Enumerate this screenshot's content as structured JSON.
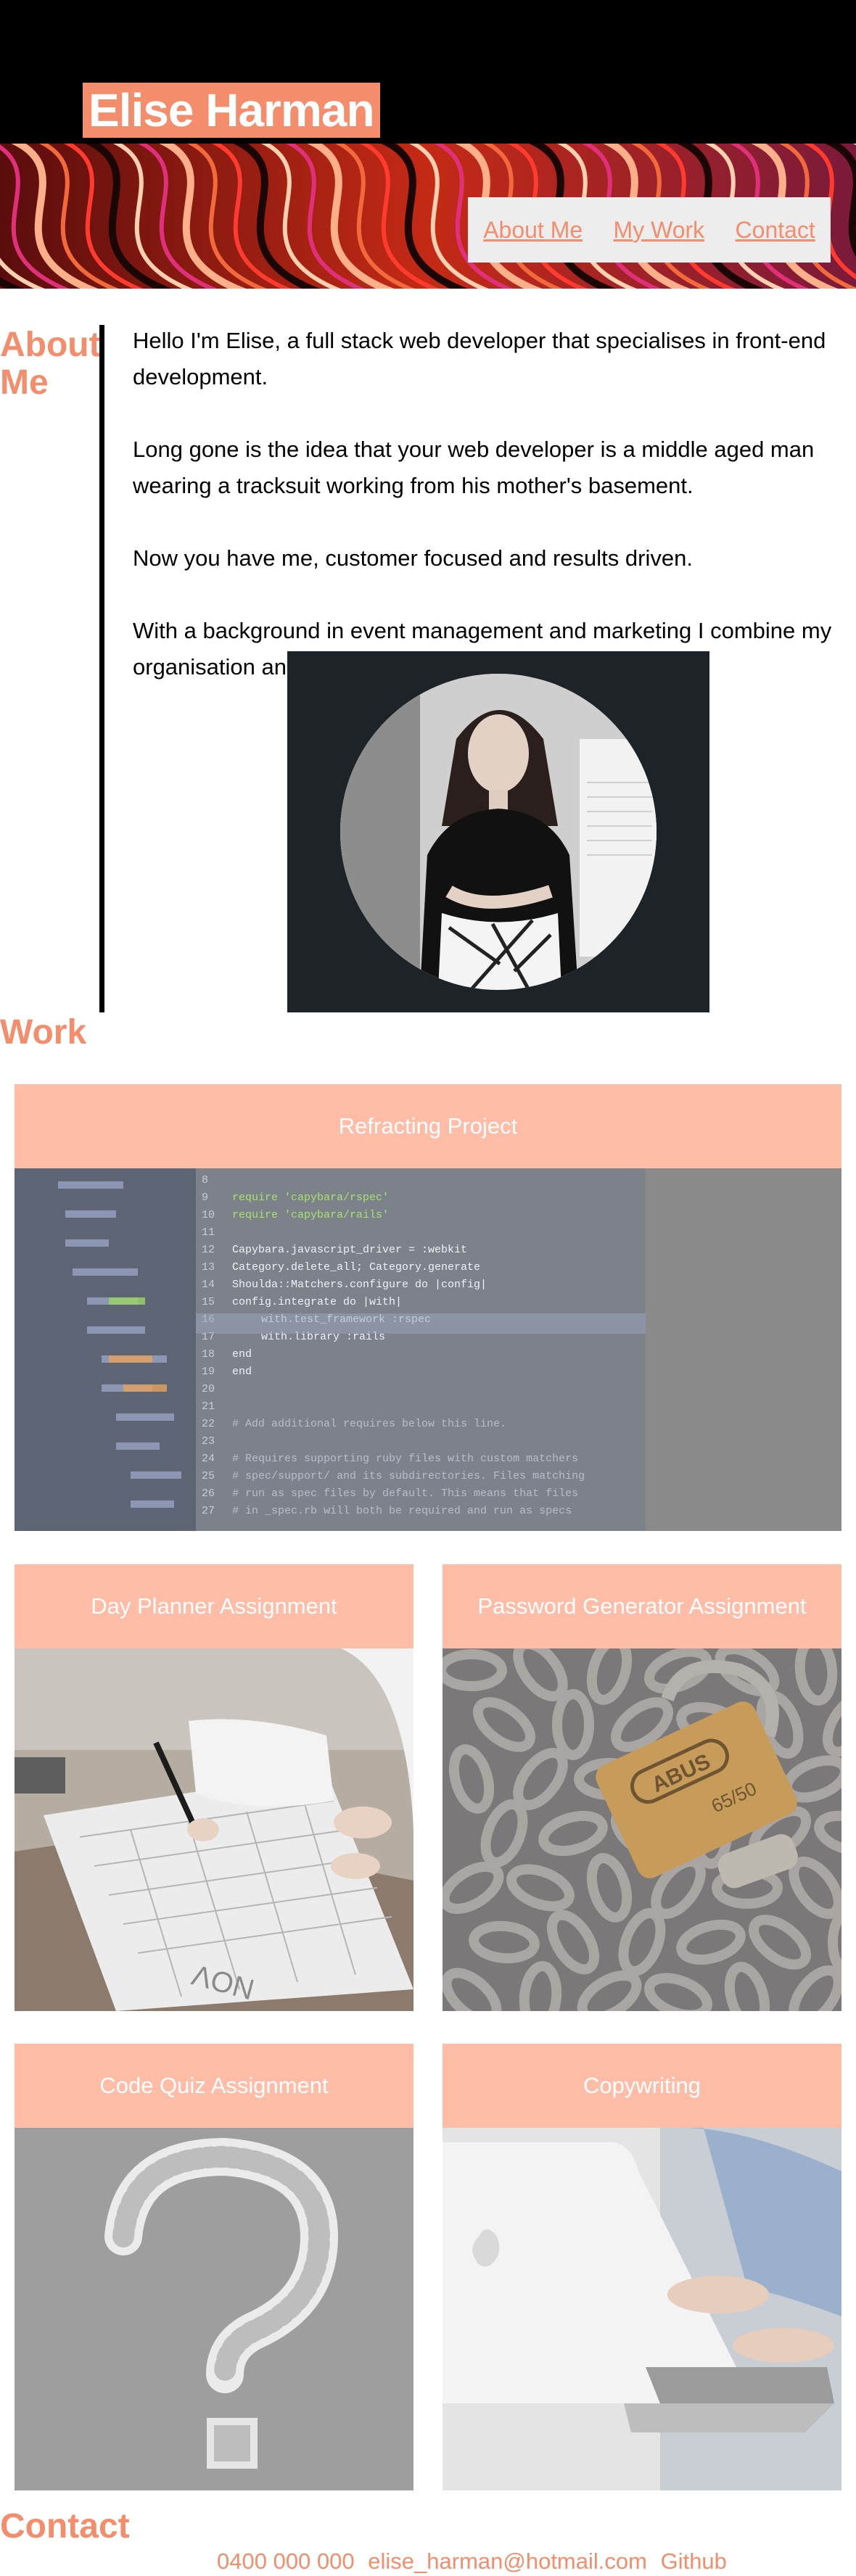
{
  "header": {
    "name": "Elise Harman",
    "nav": [
      "About Me",
      "My Work",
      "Contact"
    ]
  },
  "about": {
    "heading": "About Me",
    "paragraphs": [
      "Hello I'm Elise, a full stack web developer that specialises in front-end development.",
      "Long gone is the idea that your web developer is a middle aged man wearing a tracksuit working from his mother's basement.",
      "Now you have me, customer focused and results driven.",
      "With a background in event management and marketing I combine my organisation and creativty into desiging your website."
    ]
  },
  "work": {
    "heading": "Work",
    "projects": [
      {
        "title": "Refracting Project",
        "icon": "code-editor-image"
      },
      {
        "title": "Day Planner Assignment",
        "icon": "calendar-sketch-image"
      },
      {
        "title": "Password Generator Assignment",
        "icon": "padlock-image"
      },
      {
        "title": "Code Quiz Assignment",
        "icon": "question-mark-image"
      },
      {
        "title": "Copywriting",
        "icon": "laptop-image"
      }
    ],
    "code_lines": [
      "require 'capybara/rspec'",
      "require 'capybara/rails'",
      "Capybara.javascript_driver = :webkit",
      "Category.delete_all; Category.generate",
      "Shoulda::Matchers.configure do |config|",
      "config.integrate do |with|",
      "with.test_framework :rspec",
      "with.library :rails",
      "end",
      "end",
      "# Add additional requires below this line.",
      "# Requires supporting ruby files with custom matchers",
      "# spec/support/ and its subdirectories. Files matching",
      "# run as spec files by default. This means that files",
      "# in _spec.rb will both be required and run as specs"
    ],
    "line_numbers": [
      "8",
      "9",
      "10",
      "11",
      "12",
      "13",
      "14",
      "15",
      "16",
      "17",
      "18",
      "19",
      "20",
      "21",
      "22",
      "23",
      "24",
      "25",
      "26",
      "27"
    ],
    "lock_text": [
      "ABUS",
      "65/50"
    ],
    "calendar_text": "NOV"
  },
  "contact": {
    "heading": "Contact",
    "phone": "0400 000 000",
    "email": "elise_harman@hotmail.com",
    "github": "Github"
  },
  "colors": {
    "accent": "#f48d6c",
    "card_header": "#ffbca7",
    "photo_bg": "#1e2327",
    "nav_bg": "#ededed"
  }
}
